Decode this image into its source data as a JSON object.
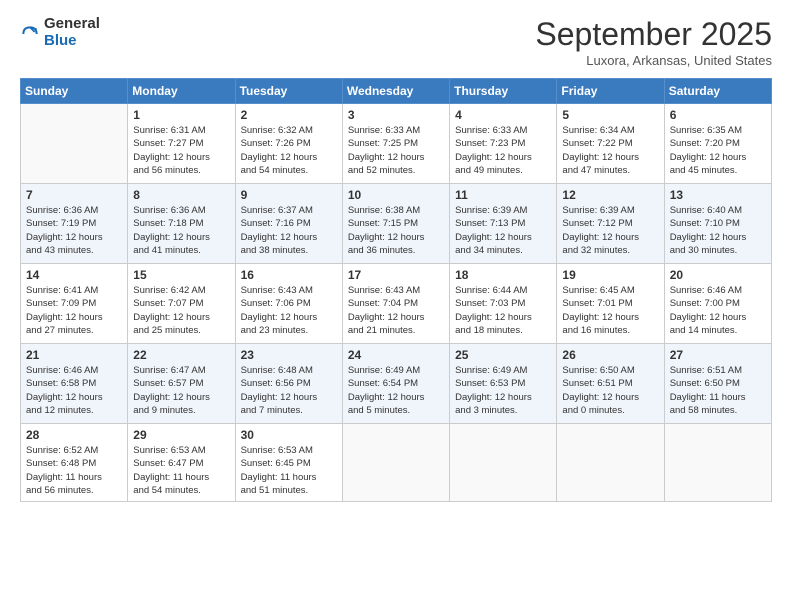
{
  "logo": {
    "general": "General",
    "blue": "Blue"
  },
  "header": {
    "month": "September 2025",
    "location": "Luxora, Arkansas, United States"
  },
  "weekdays": [
    "Sunday",
    "Monday",
    "Tuesday",
    "Wednesday",
    "Thursday",
    "Friday",
    "Saturday"
  ],
  "weeks": [
    [
      {
        "day": "",
        "info": ""
      },
      {
        "day": "1",
        "info": "Sunrise: 6:31 AM\nSunset: 7:27 PM\nDaylight: 12 hours\nand 56 minutes."
      },
      {
        "day": "2",
        "info": "Sunrise: 6:32 AM\nSunset: 7:26 PM\nDaylight: 12 hours\nand 54 minutes."
      },
      {
        "day": "3",
        "info": "Sunrise: 6:33 AM\nSunset: 7:25 PM\nDaylight: 12 hours\nand 52 minutes."
      },
      {
        "day": "4",
        "info": "Sunrise: 6:33 AM\nSunset: 7:23 PM\nDaylight: 12 hours\nand 49 minutes."
      },
      {
        "day": "5",
        "info": "Sunrise: 6:34 AM\nSunset: 7:22 PM\nDaylight: 12 hours\nand 47 minutes."
      },
      {
        "day": "6",
        "info": "Sunrise: 6:35 AM\nSunset: 7:20 PM\nDaylight: 12 hours\nand 45 minutes."
      }
    ],
    [
      {
        "day": "7",
        "info": "Sunrise: 6:36 AM\nSunset: 7:19 PM\nDaylight: 12 hours\nand 43 minutes."
      },
      {
        "day": "8",
        "info": "Sunrise: 6:36 AM\nSunset: 7:18 PM\nDaylight: 12 hours\nand 41 minutes."
      },
      {
        "day": "9",
        "info": "Sunrise: 6:37 AM\nSunset: 7:16 PM\nDaylight: 12 hours\nand 38 minutes."
      },
      {
        "day": "10",
        "info": "Sunrise: 6:38 AM\nSunset: 7:15 PM\nDaylight: 12 hours\nand 36 minutes."
      },
      {
        "day": "11",
        "info": "Sunrise: 6:39 AM\nSunset: 7:13 PM\nDaylight: 12 hours\nand 34 minutes."
      },
      {
        "day": "12",
        "info": "Sunrise: 6:39 AM\nSunset: 7:12 PM\nDaylight: 12 hours\nand 32 minutes."
      },
      {
        "day": "13",
        "info": "Sunrise: 6:40 AM\nSunset: 7:10 PM\nDaylight: 12 hours\nand 30 minutes."
      }
    ],
    [
      {
        "day": "14",
        "info": "Sunrise: 6:41 AM\nSunset: 7:09 PM\nDaylight: 12 hours\nand 27 minutes."
      },
      {
        "day": "15",
        "info": "Sunrise: 6:42 AM\nSunset: 7:07 PM\nDaylight: 12 hours\nand 25 minutes."
      },
      {
        "day": "16",
        "info": "Sunrise: 6:43 AM\nSunset: 7:06 PM\nDaylight: 12 hours\nand 23 minutes."
      },
      {
        "day": "17",
        "info": "Sunrise: 6:43 AM\nSunset: 7:04 PM\nDaylight: 12 hours\nand 21 minutes."
      },
      {
        "day": "18",
        "info": "Sunrise: 6:44 AM\nSunset: 7:03 PM\nDaylight: 12 hours\nand 18 minutes."
      },
      {
        "day": "19",
        "info": "Sunrise: 6:45 AM\nSunset: 7:01 PM\nDaylight: 12 hours\nand 16 minutes."
      },
      {
        "day": "20",
        "info": "Sunrise: 6:46 AM\nSunset: 7:00 PM\nDaylight: 12 hours\nand 14 minutes."
      }
    ],
    [
      {
        "day": "21",
        "info": "Sunrise: 6:46 AM\nSunset: 6:58 PM\nDaylight: 12 hours\nand 12 minutes."
      },
      {
        "day": "22",
        "info": "Sunrise: 6:47 AM\nSunset: 6:57 PM\nDaylight: 12 hours\nand 9 minutes."
      },
      {
        "day": "23",
        "info": "Sunrise: 6:48 AM\nSunset: 6:56 PM\nDaylight: 12 hours\nand 7 minutes."
      },
      {
        "day": "24",
        "info": "Sunrise: 6:49 AM\nSunset: 6:54 PM\nDaylight: 12 hours\nand 5 minutes."
      },
      {
        "day": "25",
        "info": "Sunrise: 6:49 AM\nSunset: 6:53 PM\nDaylight: 12 hours\nand 3 minutes."
      },
      {
        "day": "26",
        "info": "Sunrise: 6:50 AM\nSunset: 6:51 PM\nDaylight: 12 hours\nand 0 minutes."
      },
      {
        "day": "27",
        "info": "Sunrise: 6:51 AM\nSunset: 6:50 PM\nDaylight: 11 hours\nand 58 minutes."
      }
    ],
    [
      {
        "day": "28",
        "info": "Sunrise: 6:52 AM\nSunset: 6:48 PM\nDaylight: 11 hours\nand 56 minutes."
      },
      {
        "day": "29",
        "info": "Sunrise: 6:53 AM\nSunset: 6:47 PM\nDaylight: 11 hours\nand 54 minutes."
      },
      {
        "day": "30",
        "info": "Sunrise: 6:53 AM\nSunset: 6:45 PM\nDaylight: 11 hours\nand 51 minutes."
      },
      {
        "day": "",
        "info": ""
      },
      {
        "day": "",
        "info": ""
      },
      {
        "day": "",
        "info": ""
      },
      {
        "day": "",
        "info": ""
      }
    ]
  ]
}
